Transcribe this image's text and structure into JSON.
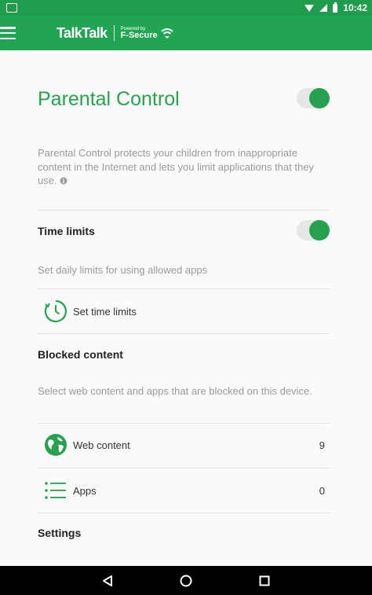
{
  "status_bar": {
    "time": "10:42"
  },
  "app_bar": {
    "brand_name": "TalkTalk",
    "powered_by": "Powered by",
    "partner": "F-Secure",
    "menu_icon": "hamburger-menu-icon"
  },
  "parental_control": {
    "title": "Parental Control",
    "enabled": true,
    "description": "Parental Control protects your children from inappropriate content in the Internet and lets you limit applications that they use.",
    "info_icon": "info-icon"
  },
  "time_limits": {
    "title": "Time limits",
    "enabled": true,
    "description": "Set daily limits for using allowed apps",
    "action_label": "Set time limits",
    "action_icon": "clock-icon"
  },
  "blocked_content": {
    "title": "Blocked content",
    "description": "Select web content and apps that are blocked on this device.",
    "items": [
      {
        "label": "Web content",
        "count": "9",
        "icon": "globe-icon"
      },
      {
        "label": "Apps",
        "count": "0",
        "icon": "list-icon"
      }
    ]
  },
  "settings": {
    "title": "Settings"
  },
  "colors": {
    "accent": "#26a24f",
    "app_bar": "#22a553",
    "status_bar": "#1f9d4c"
  },
  "nav": {
    "back": "back-icon",
    "home": "home-icon",
    "recents": "recents-icon"
  }
}
